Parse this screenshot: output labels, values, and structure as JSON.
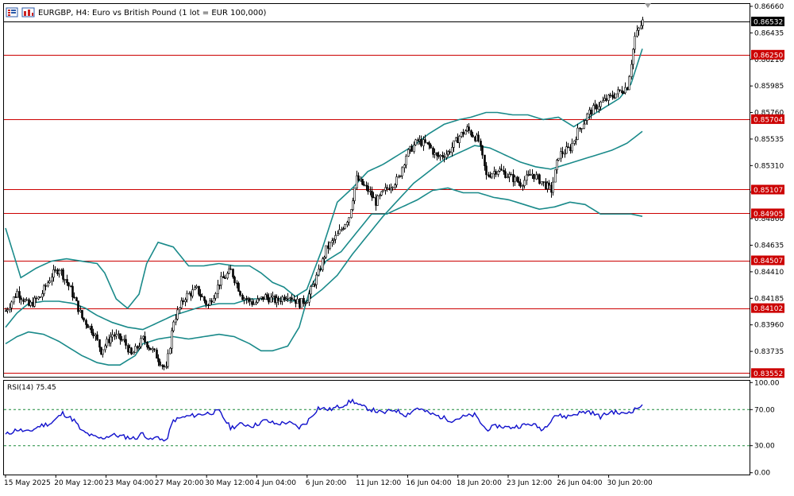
{
  "header": {
    "title": "EURGBP, H4:  Euro vs British Pound (1 lot = EUR 100,000)",
    "menu_icon": "chart-menu-icon",
    "chart_icon": "bar-chart-icon"
  },
  "colors": {
    "candle": "#000000",
    "bollinger": "#1a8a8a",
    "hline": "#cc0000",
    "hline_label_bg": "#cc0000",
    "price_label_bg": "#000000",
    "rsi_line": "#1010cc",
    "rsi_level": "#1a8a3a"
  },
  "chart_data": [
    {
      "type": "candlestick",
      "title": "EURGBP, H4:  Euro vs British Pound (1 lot = EUR 100,000)",
      "symbol": "EURGBP",
      "timeframe": "H4",
      "ylim": [
        0.8352,
        0.8668
      ],
      "y_ticks": [
        "0.86660",
        "0.86435",
        "0.86210",
        "0.85985",
        "0.85760",
        "0.85535",
        "0.85310",
        "0.85085",
        "0.84860",
        "0.84635",
        "0.84410",
        "0.84185",
        "0.83960",
        "0.83735"
      ],
      "x_ticks": [
        "15 May 2025",
        "20 May 12:00",
        "23 May 04:00",
        "27 May 20:00",
        "30 May 12:00",
        "4 Jun 04:00",
        "6 Jun 20:00",
        "11 Jun 12:00",
        "16 Jun 04:00",
        "18 Jun 20:00",
        "23 Jun 12:00",
        "26 Jun 04:00",
        "30 Jun 20:00"
      ],
      "current_price": "0.86532",
      "current_price_value": 0.86532,
      "horizontal_lines": [
        {
          "label": "0.86250",
          "value": 0.8625
        },
        {
          "label": "0.85704",
          "value": 0.85704
        },
        {
          "label": "0.85107",
          "value": 0.85107
        },
        {
          "label": "0.84905",
          "value": 0.84905
        },
        {
          "label": "0.84507",
          "value": 0.84507
        },
        {
          "label": "0.84102",
          "value": 0.84102
        },
        {
          "label": "0.83552",
          "value": 0.83552
        }
      ],
      "close_path": [
        [
          0,
          0.8408
        ],
        [
          6,
          0.8424
        ],
        [
          12,
          0.8412
        ],
        [
          18,
          0.842
        ],
        [
          24,
          0.8438
        ],
        [
          28,
          0.8444
        ],
        [
          34,
          0.8426
        ],
        [
          40,
          0.8402
        ],
        [
          46,
          0.839
        ],
        [
          50,
          0.8374
        ],
        [
          56,
          0.8388
        ],
        [
          62,
          0.8382
        ],
        [
          66,
          0.837
        ],
        [
          72,
          0.8384
        ],
        [
          78,
          0.8372
        ],
        [
          84,
          0.8358
        ],
        [
          88,
          0.84
        ],
        [
          94,
          0.842
        ],
        [
          100,
          0.8426
        ],
        [
          106,
          0.8412
        ],
        [
          112,
          0.8432
        ],
        [
          118,
          0.8442
        ],
        [
          124,
          0.842
        ],
        [
          130,
          0.8414
        ],
        [
          136,
          0.842
        ],
        [
          142,
          0.8416
        ],
        [
          148,
          0.8422
        ],
        [
          154,
          0.8414
        ],
        [
          158,
          0.8418
        ],
        [
          164,
          0.844
        ],
        [
          168,
          0.846
        ],
        [
          174,
          0.8472
        ],
        [
          180,
          0.8488
        ],
        [
          184,
          0.852
        ],
        [
          190,
          0.851
        ],
        [
          194,
          0.85
        ],
        [
          200,
          0.8512
        ],
        [
          206,
          0.852
        ],
        [
          210,
          0.854
        ],
        [
          216,
          0.8552
        ],
        [
          222,
          0.8548
        ],
        [
          226,
          0.8538
        ],
        [
          232,
          0.8542
        ],
        [
          238,
          0.8556
        ],
        [
          242,
          0.8562
        ],
        [
          248,
          0.8552
        ],
        [
          252,
          0.8522
        ],
        [
          258,
          0.8528
        ],
        [
          264,
          0.8522
        ],
        [
          270,
          0.8516
        ],
        [
          276,
          0.8524
        ],
        [
          282,
          0.8516
        ],
        [
          286,
          0.851
        ],
        [
          290,
          0.854
        ],
        [
          296,
          0.8546
        ],
        [
          300,
          0.856
        ],
        [
          306,
          0.8576
        ],
        [
          312,
          0.8584
        ],
        [
          318,
          0.859
        ],
        [
          322,
          0.8594
        ],
        [
          326,
          0.8598
        ],
        [
          330,
          0.864
        ],
        [
          334,
          0.86532
        ]
      ],
      "bb_upper_path": [
        [
          0,
          0.8478
        ],
        [
          8,
          0.8436
        ],
        [
          16,
          0.8444
        ],
        [
          24,
          0.845
        ],
        [
          32,
          0.8452
        ],
        [
          40,
          0.845
        ],
        [
          48,
          0.8448
        ],
        [
          52,
          0.844
        ],
        [
          58,
          0.8418
        ],
        [
          64,
          0.841
        ],
        [
          70,
          0.8422
        ],
        [
          74,
          0.8448
        ],
        [
          80,
          0.8466
        ],
        [
          88,
          0.8462
        ],
        [
          96,
          0.8446
        ],
        [
          104,
          0.8446
        ],
        [
          112,
          0.8448
        ],
        [
          120,
          0.8446
        ],
        [
          128,
          0.8446
        ],
        [
          134,
          0.844
        ],
        [
          140,
          0.8432
        ],
        [
          146,
          0.8428
        ],
        [
          152,
          0.842
        ],
        [
          158,
          0.8426
        ],
        [
          166,
          0.846
        ],
        [
          174,
          0.85
        ],
        [
          182,
          0.8512
        ],
        [
          190,
          0.8526
        ],
        [
          198,
          0.8532
        ],
        [
          206,
          0.854
        ],
        [
          214,
          0.8548
        ],
        [
          222,
          0.8558
        ],
        [
          230,
          0.8566
        ],
        [
          238,
          0.857
        ],
        [
          244,
          0.8572
        ],
        [
          252,
          0.8576
        ],
        [
          258,
          0.8576
        ],
        [
          266,
          0.8574
        ],
        [
          274,
          0.8574
        ],
        [
          282,
          0.857
        ],
        [
          290,
          0.8572
        ],
        [
          298,
          0.8564
        ],
        [
          306,
          0.8572
        ],
        [
          314,
          0.858
        ],
        [
          322,
          0.8588
        ],
        [
          328,
          0.86
        ],
        [
          334,
          0.863
        ]
      ],
      "bb_middle_path": [
        [
          0,
          0.8394
        ],
        [
          6,
          0.8406
        ],
        [
          12,
          0.8414
        ],
        [
          20,
          0.8416
        ],
        [
          28,
          0.8416
        ],
        [
          36,
          0.8414
        ],
        [
          42,
          0.841
        ],
        [
          48,
          0.8404
        ],
        [
          56,
          0.8398
        ],
        [
          64,
          0.8394
        ],
        [
          72,
          0.8392
        ],
        [
          80,
          0.8398
        ],
        [
          88,
          0.8404
        ],
        [
          96,
          0.8408
        ],
        [
          104,
          0.8412
        ],
        [
          112,
          0.8414
        ],
        [
          120,
          0.8414
        ],
        [
          128,
          0.8418
        ],
        [
          136,
          0.8418
        ],
        [
          144,
          0.8418
        ],
        [
          152,
          0.8416
        ],
        [
          158,
          0.8416
        ],
        [
          166,
          0.8426
        ],
        [
          174,
          0.8438
        ],
        [
          182,
          0.8456
        ],
        [
          190,
          0.8472
        ],
        [
          198,
          0.8488
        ],
        [
          206,
          0.8502
        ],
        [
          214,
          0.8516
        ],
        [
          222,
          0.8526
        ],
        [
          230,
          0.8536
        ],
        [
          238,
          0.8542
        ],
        [
          246,
          0.8548
        ],
        [
          254,
          0.8546
        ],
        [
          262,
          0.854
        ],
        [
          270,
          0.8534
        ],
        [
          278,
          0.853
        ],
        [
          286,
          0.8528
        ],
        [
          294,
          0.8532
        ],
        [
          302,
          0.8536
        ],
        [
          310,
          0.854
        ],
        [
          318,
          0.8544
        ],
        [
          326,
          0.855
        ],
        [
          334,
          0.856
        ]
      ],
      "bb_lower_path": [
        [
          0,
          0.838
        ],
        [
          6,
          0.8386
        ],
        [
          12,
          0.839
        ],
        [
          20,
          0.8388
        ],
        [
          28,
          0.8382
        ],
        [
          34,
          0.8376
        ],
        [
          40,
          0.837
        ],
        [
          48,
          0.8364
        ],
        [
          54,
          0.8362
        ],
        [
          60,
          0.8362
        ],
        [
          68,
          0.837
        ],
        [
          72,
          0.838
        ],
        [
          80,
          0.8384
        ],
        [
          88,
          0.8386
        ],
        [
          96,
          0.8384
        ],
        [
          104,
          0.8386
        ],
        [
          112,
          0.8388
        ],
        [
          120,
          0.8386
        ],
        [
          128,
          0.838
        ],
        [
          134,
          0.8374
        ],
        [
          140,
          0.8374
        ],
        [
          148,
          0.8378
        ],
        [
          154,
          0.8394
        ],
        [
          160,
          0.8428
        ],
        [
          168,
          0.845
        ],
        [
          176,
          0.8458
        ],
        [
          184,
          0.8474
        ],
        [
          192,
          0.849
        ],
        [
          200,
          0.849
        ],
        [
          208,
          0.8496
        ],
        [
          216,
          0.8502
        ],
        [
          224,
          0.851
        ],
        [
          232,
          0.8512
        ],
        [
          240,
          0.8508
        ],
        [
          248,
          0.8508
        ],
        [
          256,
          0.8504
        ],
        [
          264,
          0.8502
        ],
        [
          272,
          0.8498
        ],
        [
          280,
          0.8494
        ],
        [
          288,
          0.8496
        ],
        [
          296,
          0.85
        ],
        [
          304,
          0.8498
        ],
        [
          312,
          0.849
        ],
        [
          320,
          0.849
        ],
        [
          328,
          0.849
        ],
        [
          334,
          0.8488
        ]
      ]
    },
    {
      "type": "line",
      "title": "RSI(14) 75.45",
      "ylim": [
        -2,
        102
      ],
      "y_ticks": [
        "100.00",
        "70.00",
        "30.00",
        "0.00"
      ],
      "levels": [
        70,
        30
      ],
      "last_value": 75.45,
      "series": [
        {
          "name": "RSI(14)",
          "points": [
            [
              0,
              42
            ],
            [
              6,
              48
            ],
            [
              12,
              45
            ],
            [
              18,
              52
            ],
            [
              24,
              55
            ],
            [
              30,
              66
            ],
            [
              36,
              58
            ],
            [
              40,
              46
            ],
            [
              46,
              40
            ],
            [
              50,
              38
            ],
            [
              56,
              42
            ],
            [
              62,
              40
            ],
            [
              68,
              38
            ],
            [
              72,
              44
            ],
            [
              76,
              36
            ],
            [
              80,
              40
            ],
            [
              84,
              34
            ],
            [
              88,
              58
            ],
            [
              94,
              62
            ],
            [
              100,
              64
            ],
            [
              106,
              66
            ],
            [
              112,
              68
            ],
            [
              118,
              50
            ],
            [
              124,
              54
            ],
            [
              130,
              52
            ],
            [
              136,
              58
            ],
            [
              142,
              54
            ],
            [
              148,
              56
            ],
            [
              154,
              50
            ],
            [
              158,
              56
            ],
            [
              164,
              72
            ],
            [
              170,
              70
            ],
            [
              176,
              74
            ],
            [
              182,
              80
            ],
            [
              186,
              74
            ],
            [
              192,
              70
            ],
            [
              198,
              66
            ],
            [
              204,
              70
            ],
            [
              210,
              64
            ],
            [
              216,
              72
            ],
            [
              222,
              66
            ],
            [
              228,
              62
            ],
            [
              234,
              58
            ],
            [
              240,
              62
            ],
            [
              246,
              64
            ],
            [
              252,
              48
            ],
            [
              258,
              52
            ],
            [
              264,
              50
            ],
            [
              270,
              52
            ],
            [
              276,
              54
            ],
            [
              282,
              48
            ],
            [
              288,
              64
            ],
            [
              294,
              62
            ],
            [
              300,
              66
            ],
            [
              306,
              68
            ],
            [
              312,
              62
            ],
            [
              318,
              68
            ],
            [
              324,
              65
            ],
            [
              330,
              70
            ],
            [
              334,
              75.45
            ]
          ]
        }
      ]
    }
  ]
}
